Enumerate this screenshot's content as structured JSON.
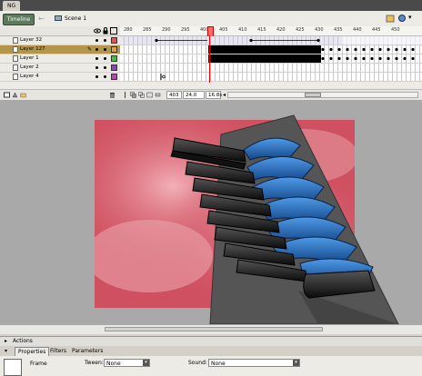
{
  "doc_tab": {
    "label": "NG"
  },
  "edit_bar": {
    "timeline_label": "Timeline",
    "scene_label": "Scene 1",
    "back_glyph": "←"
  },
  "timeline": {
    "ruler_ticks": [
      "280",
      "285",
      "290",
      "295",
      "400",
      "405",
      "410",
      "415",
      "420",
      "425",
      "430",
      "435",
      "440",
      "445",
      "450"
    ],
    "layers": [
      {
        "name": "Layer 32",
        "color": "#e85050",
        "selected": false
      },
      {
        "name": "Layer 127",
        "color": "#e0a040",
        "selected": true
      },
      {
        "name": "Layer 1",
        "color": "#40c040",
        "selected": false
      },
      {
        "name": "Layer 2",
        "color": "#9040c0",
        "selected": false
      },
      {
        "name": "Layer 4",
        "color": "#c040c0",
        "selected": false
      }
    ],
    "current_frame": "403",
    "fps": "24.0 fps",
    "elapsed": "16.8s"
  },
  "panels": {
    "actions_label": "Actions",
    "tabs": [
      "Properties",
      "Filters",
      "Parameters"
    ],
    "frame_label": "Frame",
    "tween_label": "Tween:",
    "tween_value": "None",
    "sound_label": "Sound:",
    "sound_value": "None"
  },
  "colors": {
    "canvas": "#cf5060",
    "selected_layer": "#b3964a",
    "key_blue": "#1f5fae"
  },
  "icons": [
    "scene-icon",
    "eye-icon",
    "lock-icon",
    "outline-icon",
    "pencil-icon",
    "trash-icon",
    "add-layer-icon",
    "folder-icon"
  ]
}
